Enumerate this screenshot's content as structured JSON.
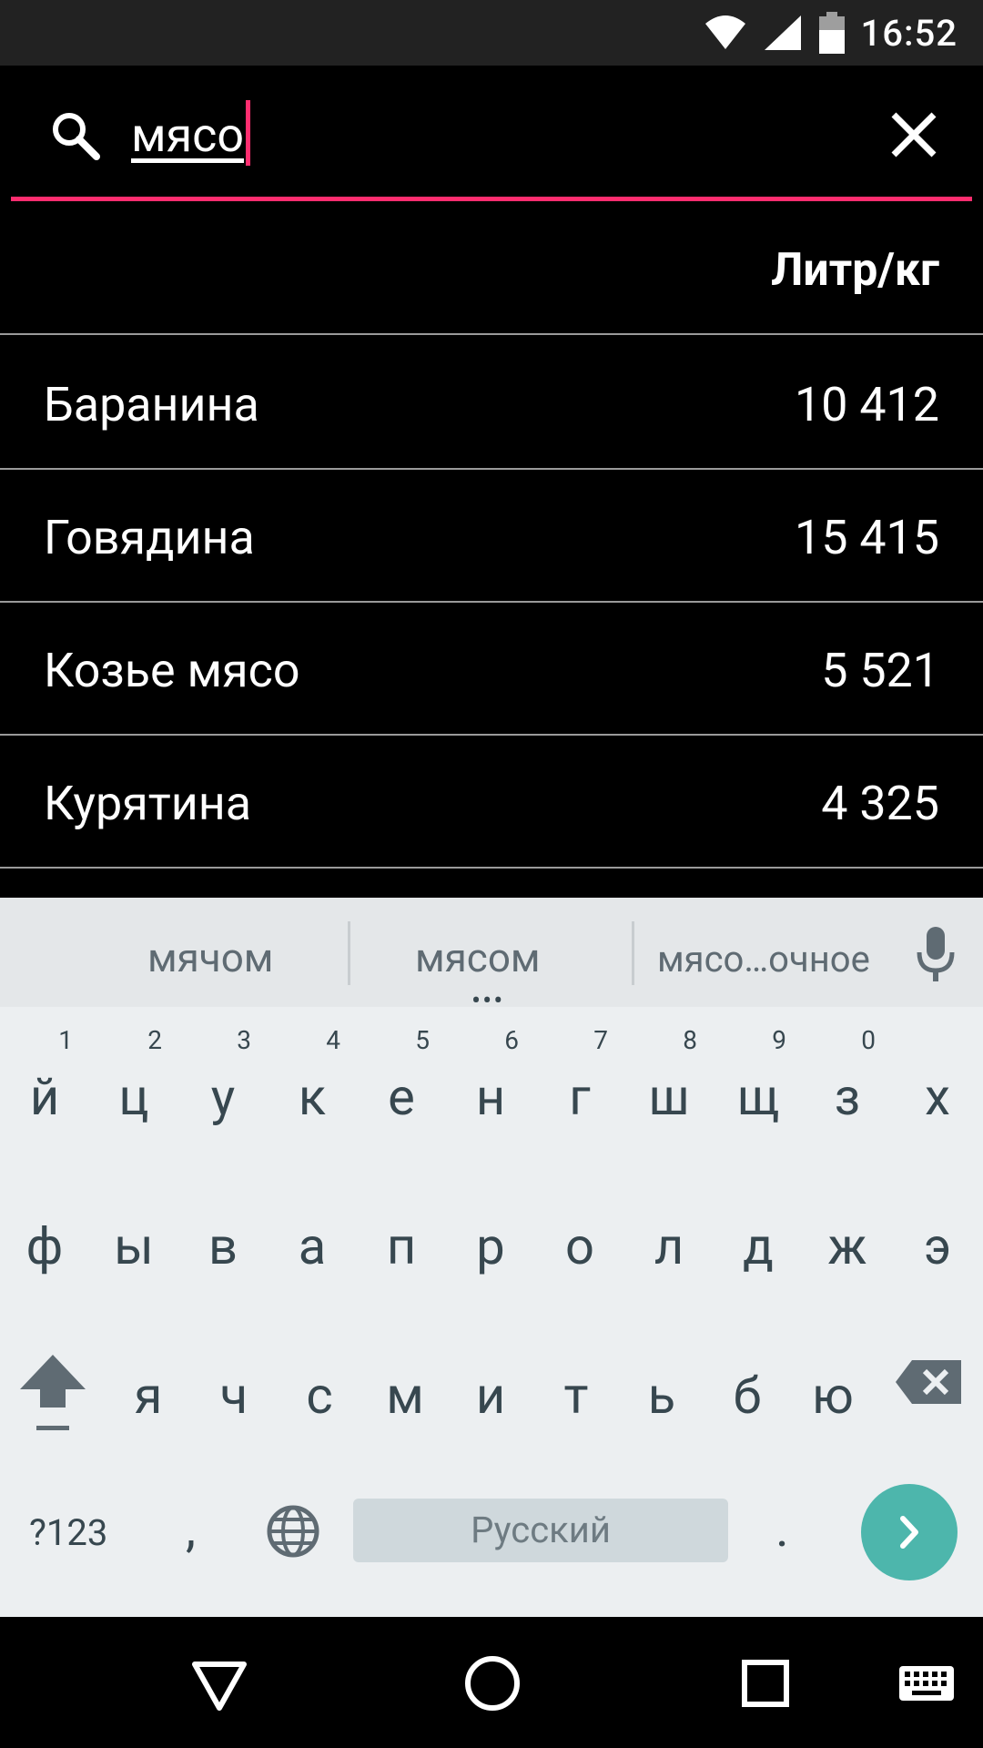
{
  "status_bar": {
    "time": "16:52",
    "icons": [
      "wifi-icon",
      "signal-icon",
      "battery-icon"
    ]
  },
  "search": {
    "query": "мясо",
    "icon": "search-icon",
    "clear_icon": "close-icon",
    "accent_color": "#ff2d6f"
  },
  "table": {
    "column_header": "Литр/кг",
    "rows": [
      {
        "name": "Баранина",
        "value": "10 412"
      },
      {
        "name": "Говядина",
        "value": "15 415"
      },
      {
        "name": "Козье мясо",
        "value": "5 521"
      },
      {
        "name": "Курятина",
        "value": "4 325"
      }
    ]
  },
  "keyboard": {
    "suggestions": [
      "мячом",
      "мясом",
      "мясо…очное"
    ],
    "suggestion_more": "•••",
    "row1": [
      {
        "key": "й",
        "hint": "1"
      },
      {
        "key": "ц",
        "hint": "2"
      },
      {
        "key": "у",
        "hint": "3"
      },
      {
        "key": "к",
        "hint": "4"
      },
      {
        "key": "е",
        "hint": "5"
      },
      {
        "key": "н",
        "hint": "6"
      },
      {
        "key": "г",
        "hint": "7"
      },
      {
        "key": "ш",
        "hint": "8"
      },
      {
        "key": "щ",
        "hint": "9"
      },
      {
        "key": "з",
        "hint": "0"
      },
      {
        "key": "х",
        "hint": ""
      }
    ],
    "row2": [
      "ф",
      "ы",
      "в",
      "а",
      "п",
      "р",
      "о",
      "л",
      "д",
      "ж",
      "э"
    ],
    "row3": [
      "я",
      "ч",
      "с",
      "м",
      "и",
      "т",
      "ь",
      "б",
      "ю"
    ],
    "symbols_key": "?123",
    "comma_key": ",",
    "space_label": "Русский",
    "period_key": ".",
    "accent_color": "#4db6ac"
  },
  "nav_bar": {
    "icons": [
      "back-icon",
      "home-icon",
      "recents-icon",
      "keyboard-icon"
    ]
  }
}
